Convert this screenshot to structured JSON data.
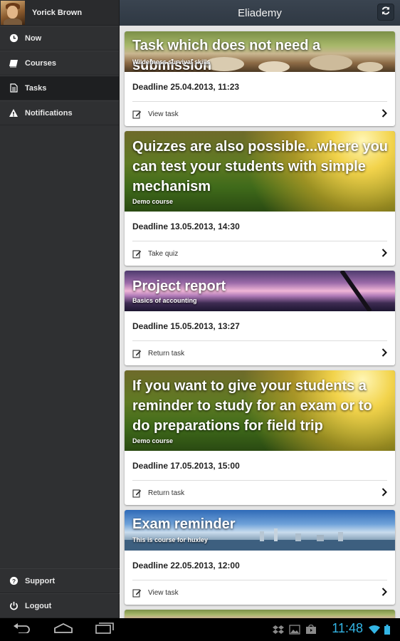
{
  "profile": {
    "name": "Yorick Brown"
  },
  "sidebar": {
    "items": [
      {
        "label": "Now",
        "icon": "clock-icon"
      },
      {
        "label": "Courses",
        "icon": "book-icon"
      },
      {
        "label": "Tasks",
        "icon": "document-icon",
        "active": true
      },
      {
        "label": "Notifications",
        "icon": "warning-icon"
      }
    ],
    "bottom_items": [
      {
        "label": "Support",
        "icon": "question-icon"
      },
      {
        "label": "Logout",
        "icon": "power-icon"
      }
    ]
  },
  "header": {
    "title": "Eliademy",
    "refresh_icon": "refresh-icon"
  },
  "tasks": [
    {
      "title": "Task which does not need a submission",
      "course": "Wilderness survival skills",
      "deadline": "Deadline 25.04.2013, 11:23",
      "action": "View task"
    },
    {
      "title": "Quizzes are also possible...where you can test your students with simple mechanism",
      "course": "Demo course",
      "deadline": "Deadline 13.05.2013, 14:30",
      "action": "Take quiz"
    },
    {
      "title": "Project report",
      "course": "Basics of accounting",
      "deadline": "Deadline 15.05.2013, 13:27",
      "action": "Return task"
    },
    {
      "title": "If you want to give your students a reminder to study for an exam or to do preparations for field trip",
      "course": "Demo course",
      "deadline": "Deadline 17.05.2013, 15:00",
      "action": "Return task"
    },
    {
      "title": "Exam reminder",
      "course": "This is course for huxley",
      "deadline": "Deadline 22.05.2013, 12:00",
      "action": "View task"
    }
  ],
  "system": {
    "time": "11:48"
  },
  "colors": {
    "accent": "#33b5e5",
    "sidebar": "#2f3032",
    "topbar": "#343e49"
  }
}
